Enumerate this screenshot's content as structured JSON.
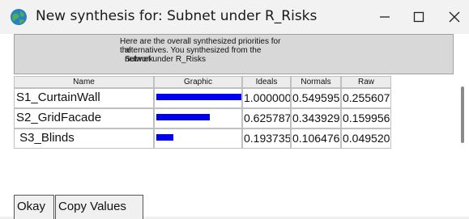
{
  "window": {
    "title": "New synthesis for: Subnet under R_Risks",
    "app_icon": "globe-icon",
    "controls": {
      "minimize": "minimize-icon",
      "maximize": "maximize-icon",
      "close": "close-icon"
    }
  },
  "message": {
    "line1": "Here are the overall synthesized priorities for the",
    "line2": "alternatives.  You synthesized from the network",
    "line3": "Subnet under R_Risks"
  },
  "table": {
    "headers": {
      "name": "Name",
      "graphic": "Graphic",
      "ideals": "Ideals",
      "normals": "Normals",
      "raw": "Raw"
    },
    "rows": [
      {
        "name": "S1_CurtainWall",
        "ideal_fraction": 1.0,
        "ideals": "1.000000",
        "normals": "0.549595",
        "raw": "0.255607"
      },
      {
        "name": "S2_GridFacade",
        "ideal_fraction": 0.625787,
        "ideals": "0.625787",
        "normals": "0.343929",
        "raw": "0.159956"
      },
      {
        "name": " S3_Blinds",
        "ideal_fraction": 0.193735,
        "ideals": "0.193735",
        "normals": "0.106476",
        "raw": "0.049520"
      }
    ],
    "bar_color": "#0000ee"
  },
  "buttons": {
    "okay": "Okay",
    "copy": "Copy Values"
  }
}
